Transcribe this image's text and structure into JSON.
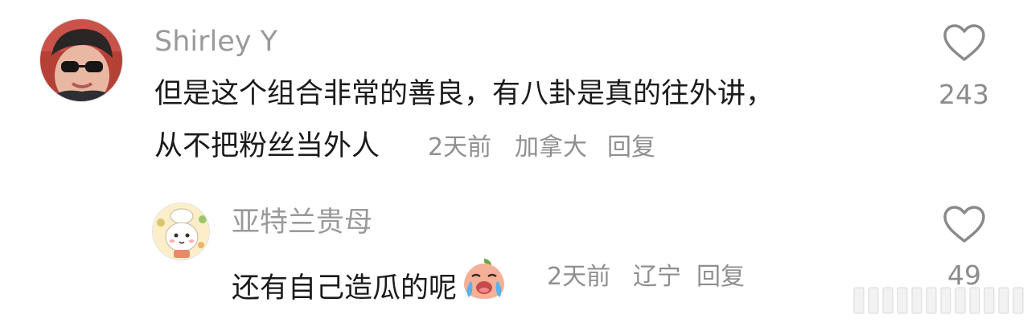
{
  "comments": [
    {
      "username": "Shirley Y",
      "text_line1": "但是这个组合非常的善良，有八卦是真的往外讲，",
      "text_line2": "从不把粉丝当外人",
      "time": "2天前",
      "location": "加拿大",
      "reply_label": "回复",
      "like_count": "243",
      "avatar_icon": "avatar-woman-sunglasses"
    },
    {
      "username": "亚特兰贵母",
      "text": "还有自己造瓜的呢",
      "emoji": "crying-peach-emoji",
      "time": "2天前",
      "location": "辽宁",
      "reply_label": "回复",
      "like_count": "49",
      "avatar_icon": "avatar-cartoon-chef-bunny"
    }
  ],
  "colors": {
    "username": "#9a9a9a",
    "text": "#1b1b1b",
    "meta": "#8f8f8f",
    "like_outline": "#8a8a8a"
  },
  "watermark": "weibo-watermark"
}
